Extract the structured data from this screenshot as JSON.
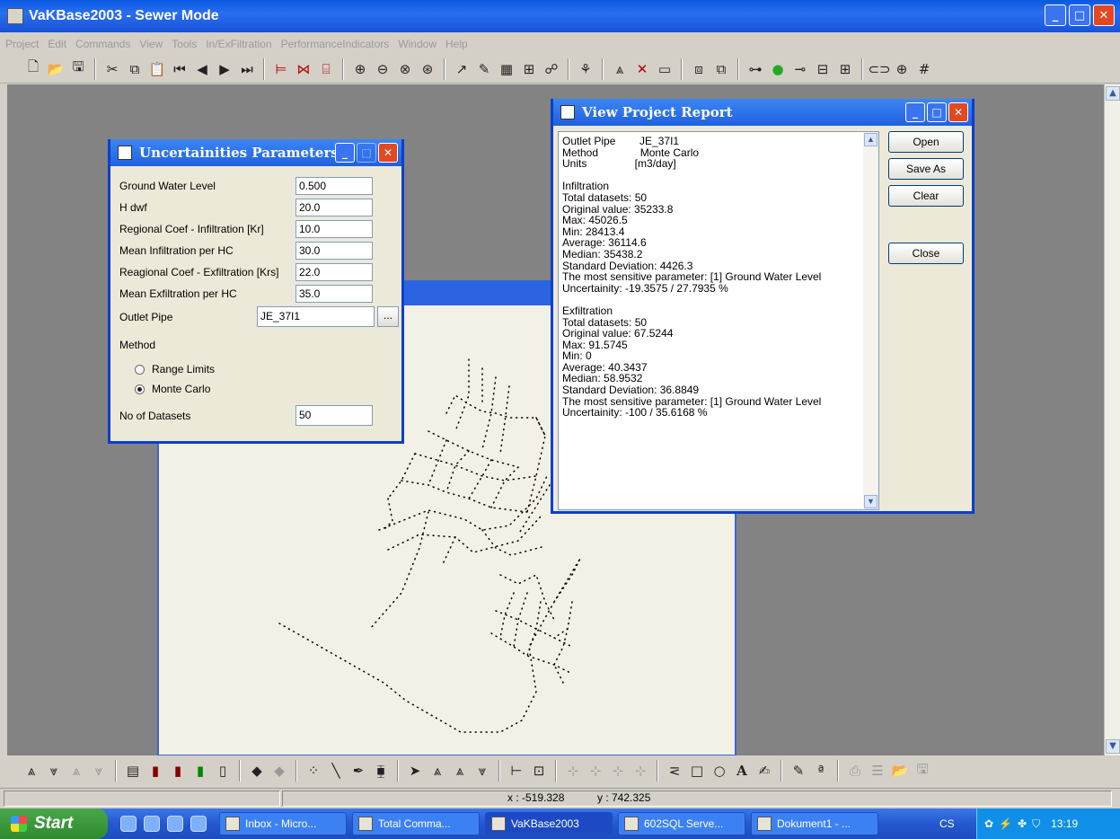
{
  "app": {
    "title": "VaKBase2003 - Sewer Mode"
  },
  "menu": [
    "Project",
    "Edit",
    "Commands",
    "View",
    "Tools",
    "In/ExFiltration",
    "PerformanceIndicators",
    "Window",
    "Help"
  ],
  "params_dialog": {
    "title": "Uncertainities Parameters",
    "fields": [
      {
        "label": "Ground Water Level",
        "value": "0.500"
      },
      {
        "label": "H dwf",
        "value": "20.0"
      },
      {
        "label": "Regional Coef - Infiltration [Kr]",
        "value": "10.0"
      },
      {
        "label": "Mean Infiltration per HC",
        "value": "30.0"
      },
      {
        "label": "Reagional Coef - Exfiltration [Krs]",
        "value": "22.0"
      },
      {
        "label": "Mean Exfiltration per HC",
        "value": "35.0"
      }
    ],
    "outlet_label": "Outlet Pipe",
    "outlet_value": "JE_37I1",
    "browse_label": "...",
    "method_label": "Method",
    "methods": [
      {
        "label": "Range Limits",
        "selected": false
      },
      {
        "label": "Monte Carlo",
        "selected": true
      }
    ],
    "datasets_label": "No of Datasets",
    "datasets_value": "50"
  },
  "report_dialog": {
    "title": "View Project Report",
    "lines": [
      "Outlet Pipe        JE_37I1",
      "Method              Monte Carlo",
      "Units                [m3/day]",
      "",
      "Infiltration",
      "Total datasets: 50",
      "Original value: 35233.8",
      "Max: 45026.5",
      "Min: 28413.4",
      "Average: 36114.6",
      "Median: 35438.2",
      "Standard Deviation: 4426.3",
      "The most sensitive parameter: [1] Ground Water Level",
      "Uncertainity: -19.3575 / 27.7935 %",
      "",
      "Exfiltration",
      "Total datasets: 50",
      "Original value: 67.5244",
      "Max: 91.5745",
      "Min: 0",
      "Average: 40.3437",
      "Median: 58.9532",
      "Standard Deviation: 36.8849",
      "The most sensitive parameter: [1] Ground Water Level",
      "Uncertainity: -100 / 35.6168 %"
    ],
    "buttons": {
      "open": "Open",
      "save_as": "Save As",
      "clear": "Clear",
      "close": "Close"
    }
  },
  "status": {
    "x_label": "x : -519.328",
    "y_label": "y : 742.325"
  },
  "taskbar": {
    "start": "Start",
    "tasks": [
      "Inbox - Micro...",
      "Total Comma...",
      "VaKBase2003",
      "602SQL Serve...",
      "Dokument1 - ..."
    ],
    "active_task": "VaKBase2003",
    "lang": "CS",
    "clock": "13:19"
  }
}
